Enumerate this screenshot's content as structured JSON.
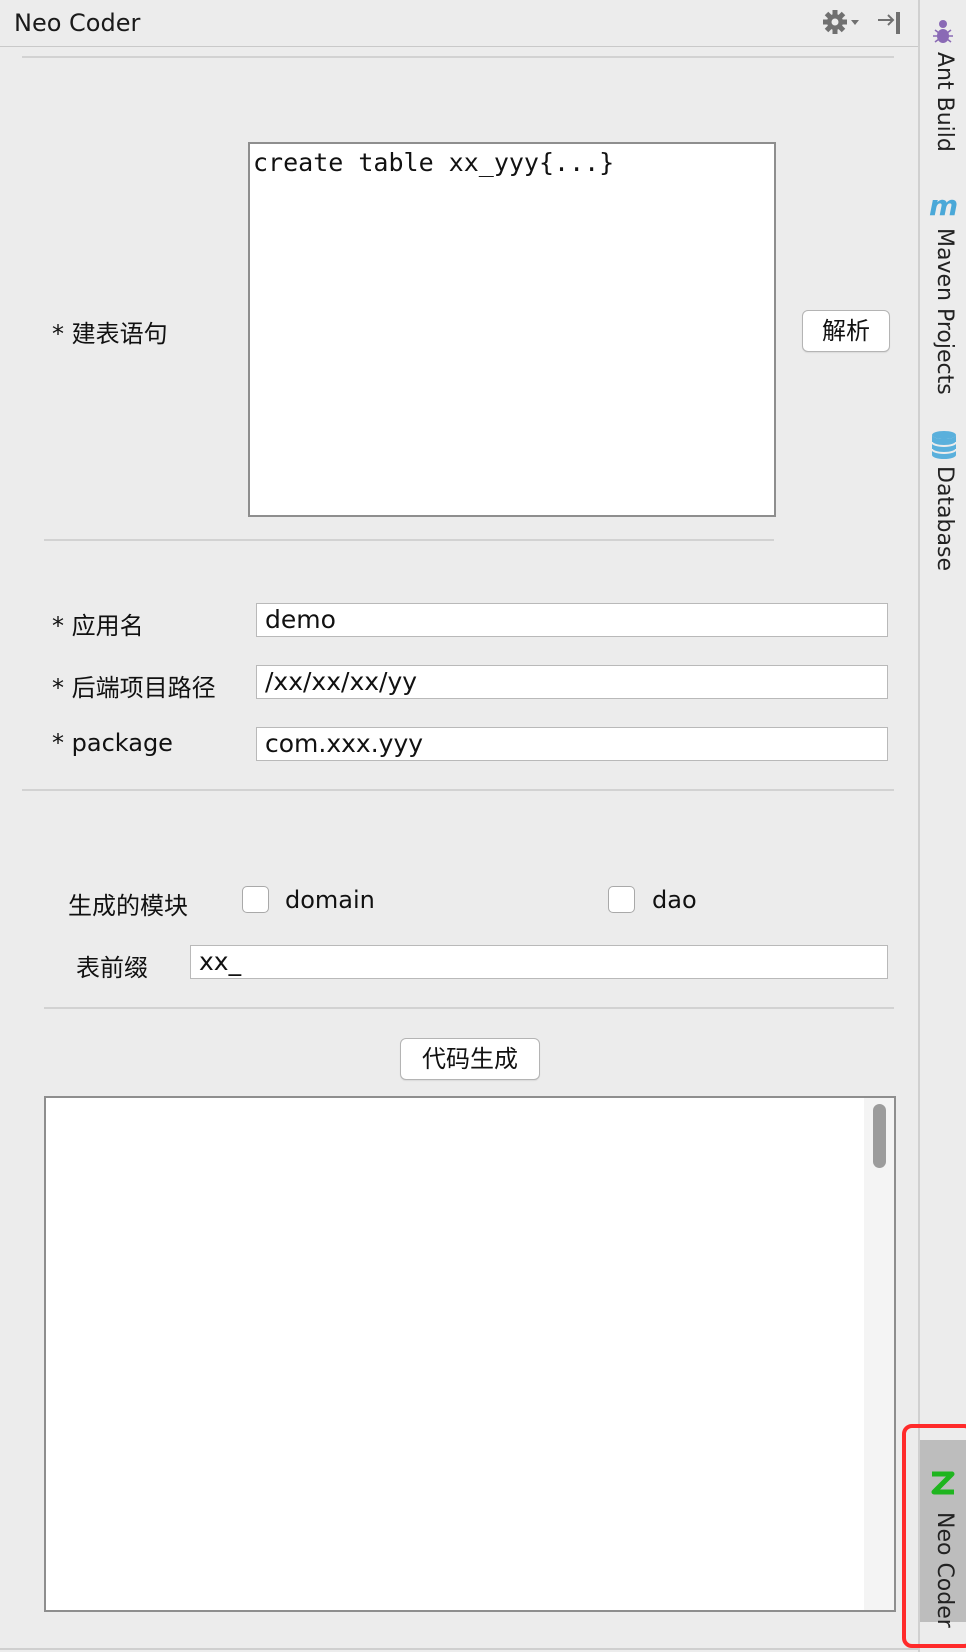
{
  "window": {
    "title": "Neo Coder"
  },
  "toolbar": {
    "settings_icon": "gear-icon",
    "hide_icon": "pin-right-icon"
  },
  "sql_section": {
    "label": "* 建表语句",
    "textarea_value": "create table xx_yyy{...}",
    "parse_button": "解析"
  },
  "project": {
    "app_name_label": "* 应用名",
    "app_name_value": "demo",
    "backend_path_label": "* 后端项目路径",
    "backend_path_value": "/xx/xx/xx/yy",
    "package_label": "* package",
    "package_value": "com.xxx.yyy"
  },
  "modules": {
    "label": "生成的模块",
    "options": [
      {
        "label": "domain",
        "checked": false
      },
      {
        "label": "dao",
        "checked": false
      }
    ]
  },
  "prefix": {
    "label": "表前缀",
    "value": "xx_"
  },
  "generate_button": "代码生成",
  "output": {
    "value": ""
  },
  "tool_windows": [
    {
      "label": "Ant Build",
      "icon": "ant-icon",
      "color": "#8a6ab5"
    },
    {
      "label": "Maven Projects",
      "icon": "maven-icon",
      "color": "#4aa8d8"
    },
    {
      "label": "Database",
      "icon": "database-icon",
      "color": "#5ab0dc"
    },
    {
      "label": "Neo Coder",
      "icon": "neo-coder-icon",
      "color": "#1fb51f",
      "active": true
    }
  ]
}
